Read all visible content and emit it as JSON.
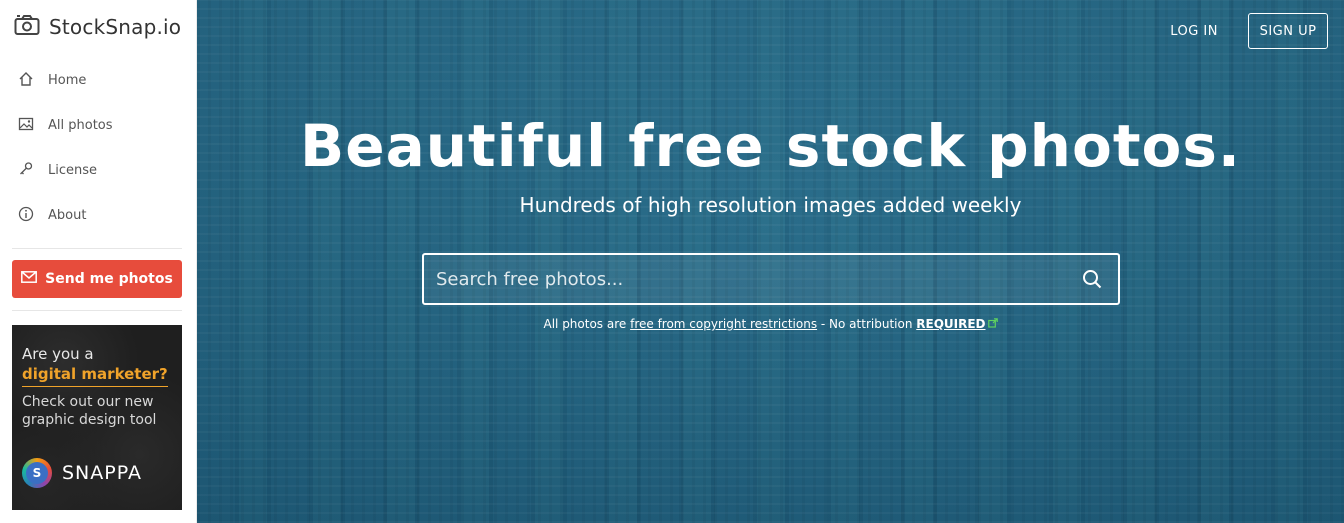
{
  "brand": {
    "name": "StockSnap.io",
    "icon": "camera-icon"
  },
  "sidebar": {
    "items": [
      {
        "label": "Home",
        "icon": "home-icon"
      },
      {
        "label": "All photos",
        "icon": "image-icon"
      },
      {
        "label": "License",
        "icon": "key-icon"
      },
      {
        "label": "About",
        "icon": "info-icon"
      }
    ],
    "send_button": {
      "label": "Send me photos",
      "icon": "mail-icon",
      "color": "#e74c3c"
    },
    "ad": {
      "line1": "Are you a",
      "line2": "digital marketer?",
      "line3a": "Check out our new",
      "line3b": "graphic design tool",
      "brand": "SNAPPA",
      "logo_letter": "S",
      "accent": "#f0a32a"
    }
  },
  "header": {
    "login": "LOG IN",
    "signup": "SIGN UP"
  },
  "hero": {
    "title": "Beautiful free stock photos.",
    "subtitle": "Hundreds of high resolution images added weekly",
    "search": {
      "placeholder": "Search free photos...",
      "icon": "search-icon"
    },
    "notice": {
      "prefix": "All photos are ",
      "link": "free from copyright restrictions",
      "middle": " - No attribution ",
      "required": "REQUIRED",
      "icon": "external-link-icon"
    }
  }
}
